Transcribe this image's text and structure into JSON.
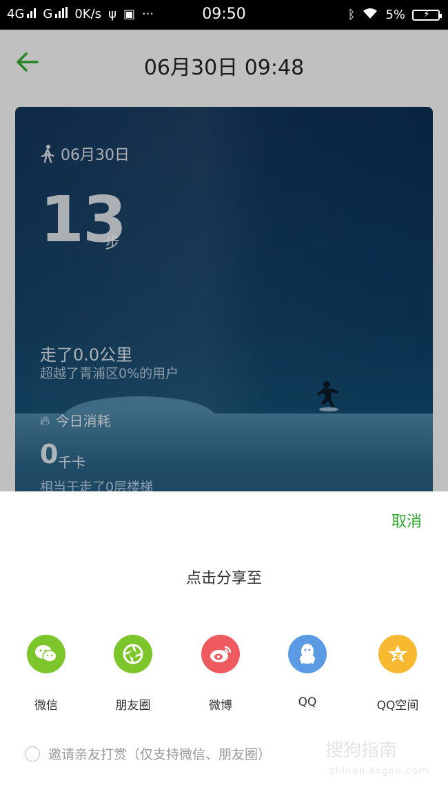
{
  "status_bar": {
    "network1": "4G",
    "network2": "G",
    "speed": "0K/s",
    "more": "···",
    "time": "09:50",
    "battery": "5%"
  },
  "header": {
    "title": "06月30日 09:48"
  },
  "card": {
    "date": "06月30日",
    "steps": "13",
    "steps_unit": "步",
    "distance": "走了0.0公里",
    "beat": "超越了青浦区0%的用户",
    "burn_label": "今日消耗",
    "kcal": "0",
    "kcal_unit": "千卡",
    "stairs": "相当于走了0层楼梯"
  },
  "share_sheet": {
    "cancel_label": "取消",
    "title": "点击分享至",
    "targets": [
      {
        "label": "微信",
        "icon": "wechat-icon",
        "color": "#7cc62c"
      },
      {
        "label": "朋友圈",
        "icon": "moments-icon",
        "color": "#7cc62c"
      },
      {
        "label": "微博",
        "icon": "weibo-icon",
        "color": "#ef5a5e"
      },
      {
        "label": "QQ",
        "icon": "qq-icon",
        "color": "#5a9be3"
      },
      {
        "label": "QQ空间",
        "icon": "qzone-icon",
        "color": "#f6b930"
      }
    ],
    "reward_label": "邀请亲友打赏（仅支持微信、朋友圈）"
  },
  "watermark": {
    "text": "搜狗指南",
    "url": "zhinan.sogou.com"
  },
  "colors": {
    "accent": "#2faa2f"
  }
}
